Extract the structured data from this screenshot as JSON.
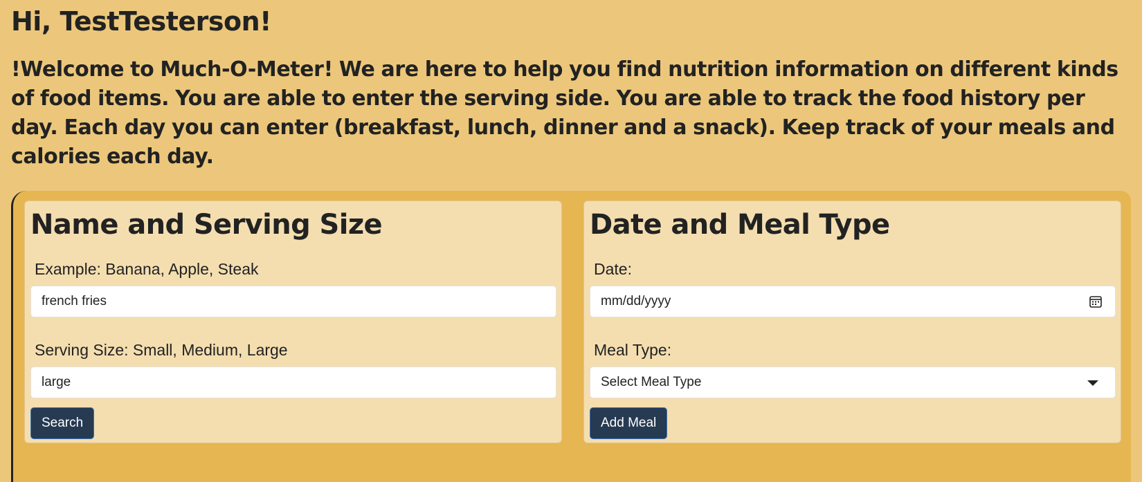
{
  "header": {
    "greeting": "Hi, TestTesterson!",
    "welcome": "!Welcome to Much-O-Meter! We are here to help you find nutrition information on different kinds of food items. You are able to enter the serving side. You are able to track the food history per day. Each day you can enter (breakfast, lunch, dinner and a snack). Keep track of your meals and calories each day."
  },
  "search_card": {
    "title": "Name and Serving Size",
    "food_label": "Example: Banana, Apple, Steak",
    "food_value": "french fries",
    "size_label": "Serving Size: Small, Medium, Large",
    "size_value": "large",
    "search_button": "Search"
  },
  "meal_card": {
    "title": "Date and Meal Type",
    "date_label": "Date:",
    "date_placeholder": "mm/dd/yyyy",
    "meal_label": "Meal Type:",
    "meal_selected": "Select Meal Type",
    "add_button": "Add Meal"
  },
  "colors": {
    "page_bg": "#ecc77b",
    "panel_bg": "#e6b652",
    "card_bg": "#f4deb0",
    "button_bg": "#263a52"
  },
  "icons": {
    "date_picker": "calendar-icon",
    "select_toggle": "caret-down-icon"
  }
}
